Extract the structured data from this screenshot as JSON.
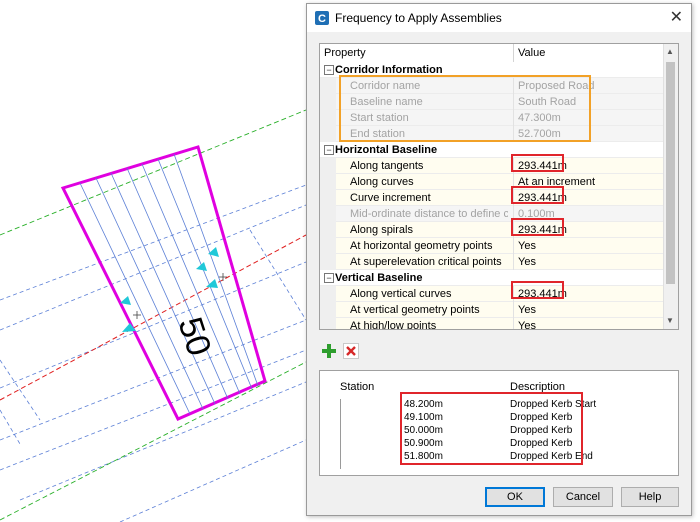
{
  "drawing": {
    "station_label": "50",
    "colors": {
      "boundary": "#e000e0",
      "centerline": "#e02020",
      "offset": "#2ab02a",
      "grid": "#5b7fd6",
      "marker": "#20c8d8"
    }
  },
  "dialog": {
    "title": "Frequency to Apply Assemblies",
    "app_icon": "civil3d-app-icon",
    "close_icon": "close-icon",
    "grid": {
      "col_property": "Property",
      "col_value": "Value",
      "rows": [
        {
          "type": "category",
          "label": "Corridor Information",
          "toggle": "−"
        },
        {
          "type": "disabled",
          "label": "Corridor name",
          "value": "Proposed Road"
        },
        {
          "type": "disabled",
          "label": "Baseline name",
          "value": "South Road"
        },
        {
          "type": "disabled",
          "label": "Start station",
          "value": "47.300m"
        },
        {
          "type": "disabled",
          "label": "End station",
          "value": "52.700m"
        },
        {
          "type": "category",
          "label": "Horizontal Baseline",
          "toggle": "−"
        },
        {
          "type": "prop",
          "label": "Along tangents",
          "value": "293.441m"
        },
        {
          "type": "prop",
          "label": "Along curves",
          "value": "At an increment"
        },
        {
          "type": "prop",
          "label": "Curve increment",
          "value": "293.441m"
        },
        {
          "type": "disabled",
          "label": "Mid-ordinate distance to define cur...",
          "value": "0.100m"
        },
        {
          "type": "prop",
          "label": "Along spirals",
          "value": "293.441m"
        },
        {
          "type": "prop",
          "label": "At horizontal geometry points",
          "value": "Yes"
        },
        {
          "type": "prop",
          "label": "At superelevation critical points",
          "value": "Yes"
        },
        {
          "type": "category",
          "label": "Vertical Baseline",
          "toggle": "−"
        },
        {
          "type": "prop",
          "label": "Along vertical curves",
          "value": "293.441m"
        },
        {
          "type": "prop",
          "label": "At vertical geometry points",
          "value": "Yes"
        },
        {
          "type": "prop",
          "label": "At high/low points",
          "value": "Yes"
        }
      ]
    },
    "list": {
      "col_station": "Station",
      "col_description": "Description",
      "rows": [
        {
          "station": "48.200m",
          "description": "Dropped Kerb Start"
        },
        {
          "station": "49.100m",
          "description": "Dropped Kerb"
        },
        {
          "station": "50.000m",
          "description": "Dropped Kerb"
        },
        {
          "station": "50.900m",
          "description": "Dropped Kerb"
        },
        {
          "station": "51.800m",
          "description": "Dropped Kerb End"
        }
      ]
    },
    "buttons": {
      "ok": "OK",
      "cancel": "Cancel",
      "help": "Help"
    },
    "icons": {
      "add": "add-icon",
      "delete": "delete-icon"
    },
    "highlight_colors": {
      "red": "#e0252b",
      "orange": "#f2a127"
    }
  }
}
